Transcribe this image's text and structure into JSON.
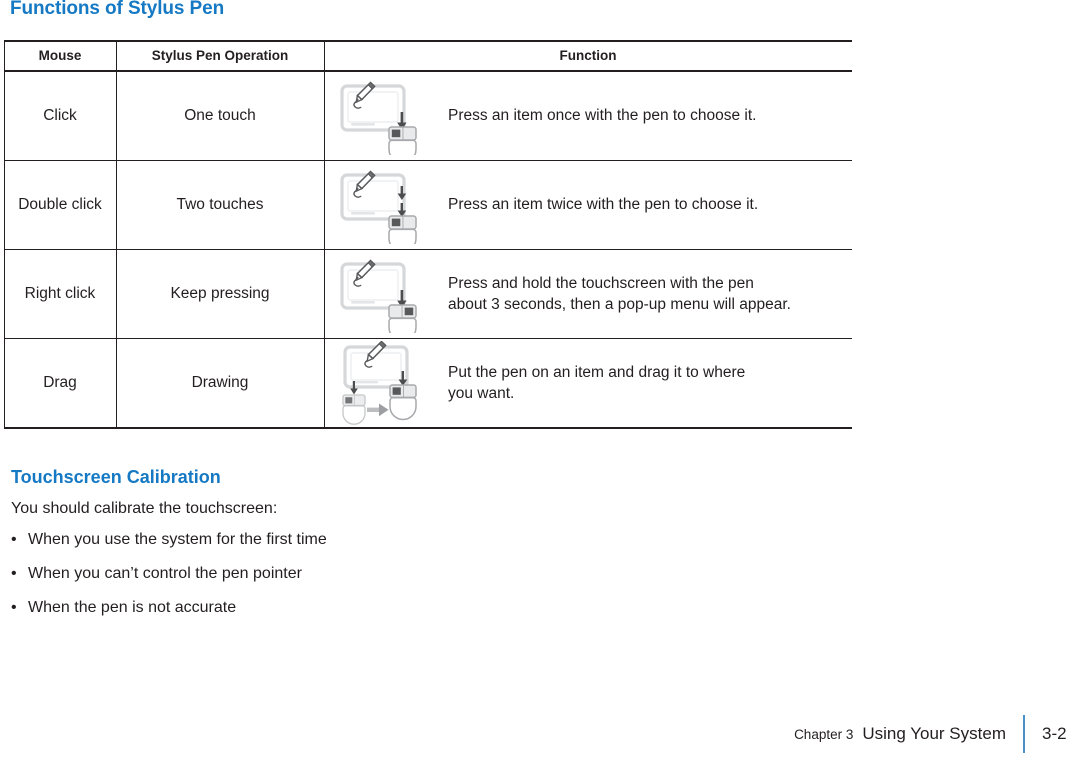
{
  "page": {
    "heading": "Functions of Stylus Pen",
    "accent_color": "#1579C4",
    "text_color": "#231F20",
    "rule_color": "#4A90C8"
  },
  "table": {
    "columns": [
      "Mouse",
      "Stylus Pen Operation",
      "Function"
    ],
    "rows": [
      {
        "mouse": "Click",
        "operation": "One touch",
        "function": "Press an item once with the pen to choose it.",
        "icon": "tablet-pen-mouse-single-click-icon"
      },
      {
        "mouse": "Double click",
        "operation": "Two touches",
        "function": "Press an item twice with the pen to choose it.",
        "icon": "tablet-pen-mouse-double-click-icon"
      },
      {
        "mouse": "Right click",
        "operation": "Keep pressing",
        "function": "Press and hold the touchscreen with the pen\nabout 3 seconds, then a pop-up menu will appear.",
        "function_line1": "Press and hold the touchscreen with the pen",
        "function_line2": "about 3 seconds, then a pop-up menu will appear.",
        "icon": "tablet-pen-mouse-right-click-icon"
      },
      {
        "mouse": "Drag",
        "operation": "Drawing",
        "function": "Put the pen on an item and drag it to where\nyou want.",
        "function_line1": "Put the pen on an item and drag it to where",
        "function_line2": "you want.",
        "icon": "tablet-pen-mouse-drag-icon"
      }
    ]
  },
  "calibration": {
    "heading": "Touchscreen Calibration",
    "intro": "You should calibrate the touchscreen:",
    "bullet_char": "•",
    "items": [
      "When you use the system for the first time",
      "When you can’t control the pen pointer",
      "When the pen is not accurate"
    ]
  },
  "footer": {
    "chapter": "Chapter 3",
    "title": "Using Your System",
    "page_number": "3-2"
  }
}
